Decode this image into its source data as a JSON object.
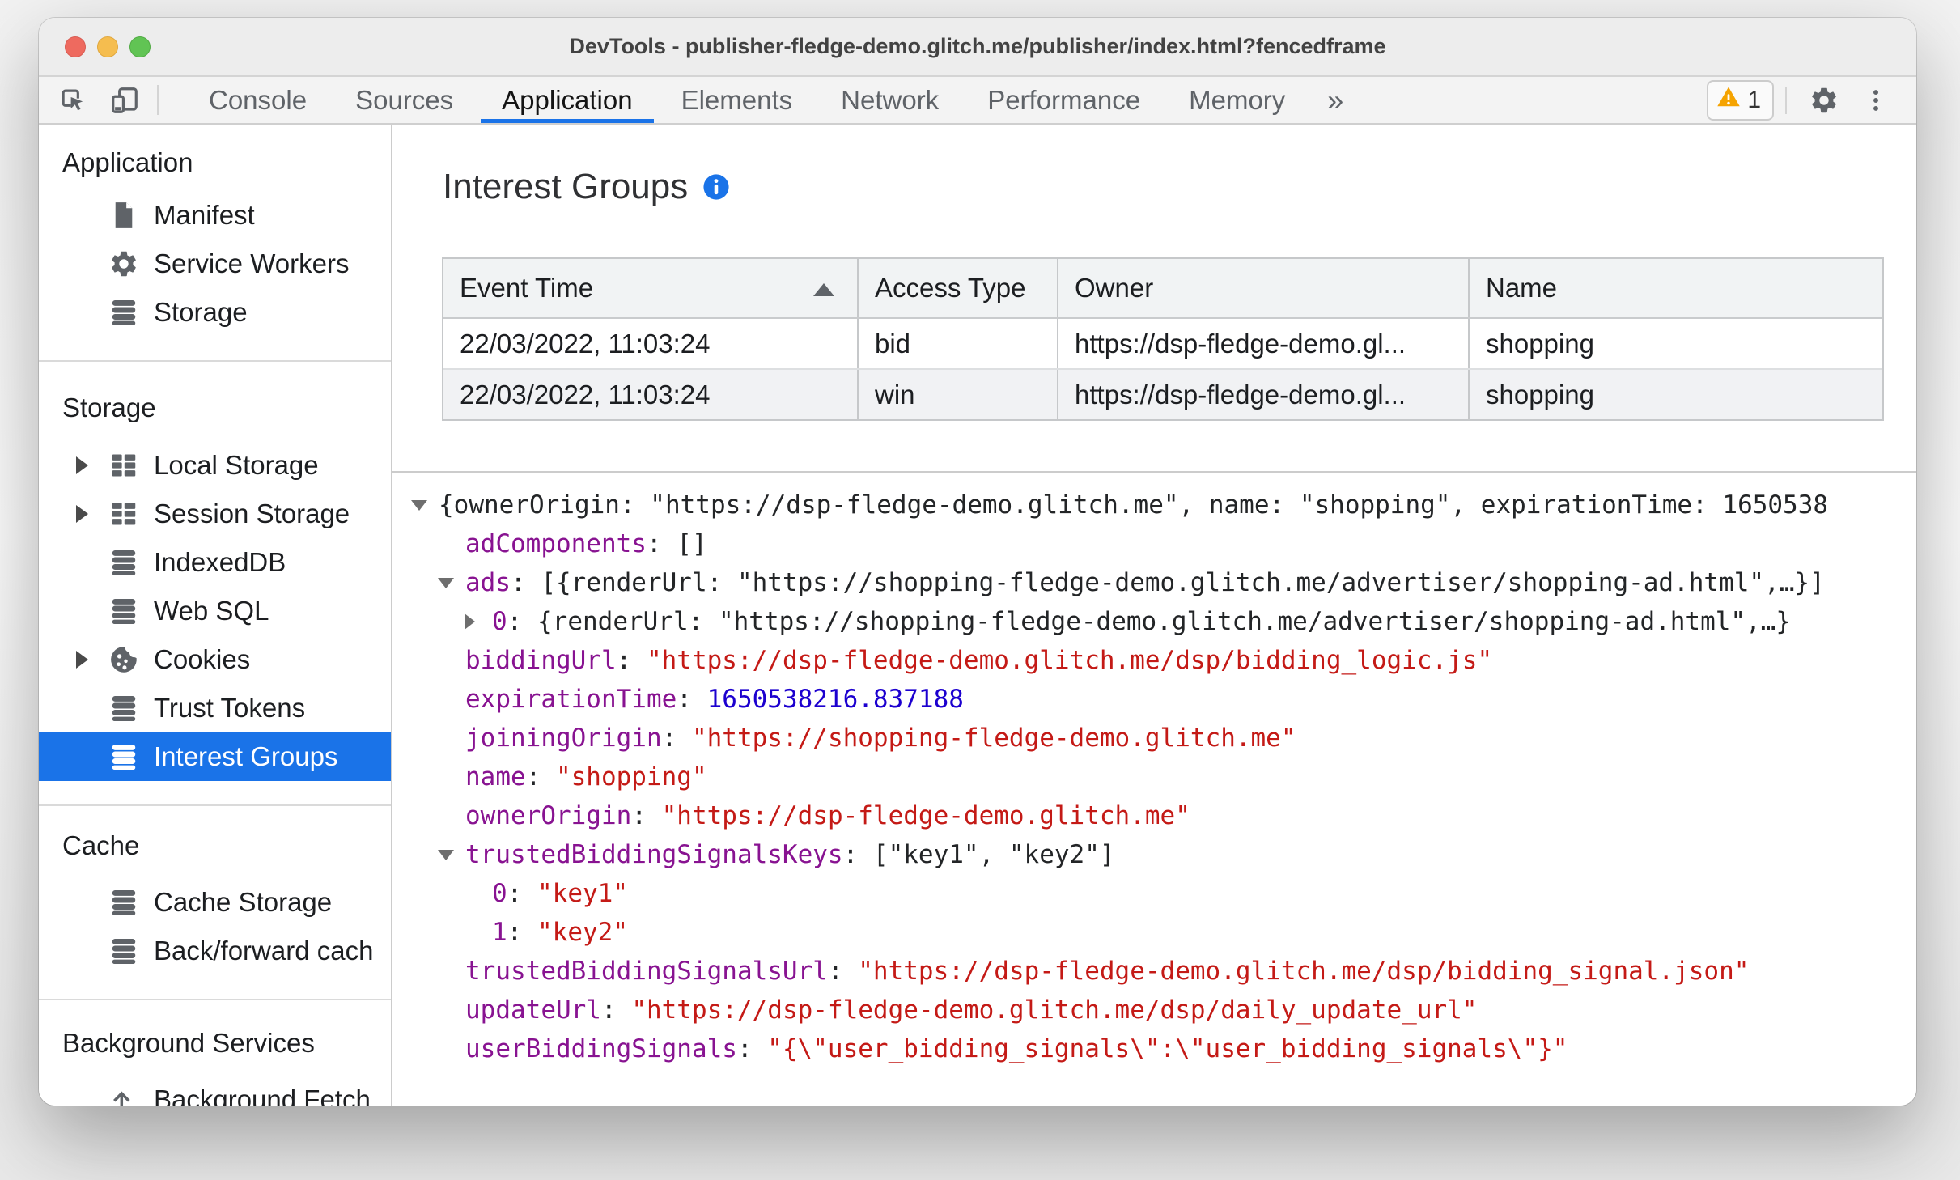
{
  "window": {
    "title": "DevTools - publisher-fledge-demo.glitch.me/publisher/index.html?fencedframe"
  },
  "toolbar": {
    "tabs": [
      "Console",
      "Sources",
      "Application",
      "Elements",
      "Network",
      "Performance",
      "Memory"
    ],
    "active_tab": "Application",
    "more_tabs_label": "»",
    "warning_count": "1"
  },
  "sidebar": {
    "sections": [
      {
        "title": "Application",
        "items": [
          {
            "label": "Manifest",
            "icon": "document-icon",
            "expandable": false
          },
          {
            "label": "Service Workers",
            "icon": "gear-icon",
            "expandable": false
          },
          {
            "label": "Storage",
            "icon": "database-icon",
            "expandable": false
          }
        ]
      },
      {
        "title": "Storage",
        "items": [
          {
            "label": "Local Storage",
            "icon": "grid-icon",
            "expandable": true
          },
          {
            "label": "Session Storage",
            "icon": "grid-icon",
            "expandable": true
          },
          {
            "label": "IndexedDB",
            "icon": "database-icon",
            "expandable": false
          },
          {
            "label": "Web SQL",
            "icon": "database-icon",
            "expandable": false
          },
          {
            "label": "Cookies",
            "icon": "cookie-icon",
            "expandable": true
          },
          {
            "label": "Trust Tokens",
            "icon": "database-icon",
            "expandable": false
          },
          {
            "label": "Interest Groups",
            "icon": "database-icon",
            "expandable": false,
            "selected": true
          }
        ]
      },
      {
        "title": "Cache",
        "items": [
          {
            "label": "Cache Storage",
            "icon": "database-icon",
            "expandable": false
          },
          {
            "label": "Back/forward cach",
            "icon": "database-icon",
            "expandable": false
          }
        ]
      },
      {
        "title": "Background Services",
        "items": [
          {
            "label": "Background Fetch",
            "icon": "fetch-icon",
            "expandable": false
          }
        ]
      }
    ]
  },
  "main": {
    "title": "Interest Groups",
    "table": {
      "columns": [
        "Event Time",
        "Access Type",
        "Owner",
        "Name"
      ],
      "sorted_column": "Event Time",
      "sort_direction": "asc",
      "rows": [
        [
          "22/03/2022, 11:03:24",
          "bid",
          "https://dsp-fledge-demo.gl...",
          "shopping"
        ],
        [
          "22/03/2022, 11:03:24",
          "win",
          "https://dsp-fledge-demo.gl...",
          "shopping"
        ]
      ]
    },
    "tree": {
      "rows": [
        {
          "indent": 0,
          "arrow": "down",
          "key": "",
          "value": "{ownerOrigin: \"https://dsp-fledge-demo.glitch.me\", name: \"shopping\", expirationTime: 1650538",
          "type": "preview"
        },
        {
          "indent": 1,
          "arrow": "",
          "key": "adComponents",
          "value": "[]",
          "type": "preview"
        },
        {
          "indent": 1,
          "arrow": "down",
          "key": "ads",
          "value": "[{renderUrl: \"https://shopping-fledge-demo.glitch.me/advertiser/shopping-ad.html\",…}]",
          "type": "preview"
        },
        {
          "indent": 2,
          "arrow": "right",
          "key": "0",
          "value": "{renderUrl: \"https://shopping-fledge-demo.glitch.me/advertiser/shopping-ad.html\",…}",
          "type": "preview"
        },
        {
          "indent": 1,
          "arrow": "",
          "key": "biddingUrl",
          "value": "\"https://dsp-fledge-demo.glitch.me/dsp/bidding_logic.js\"",
          "type": "string"
        },
        {
          "indent": 1,
          "arrow": "",
          "key": "expirationTime",
          "value": "1650538216.837188",
          "type": "number"
        },
        {
          "indent": 1,
          "arrow": "",
          "key": "joiningOrigin",
          "value": "\"https://shopping-fledge-demo.glitch.me\"",
          "type": "string"
        },
        {
          "indent": 1,
          "arrow": "",
          "key": "name",
          "value": "\"shopping\"",
          "type": "string"
        },
        {
          "indent": 1,
          "arrow": "",
          "key": "ownerOrigin",
          "value": "\"https://dsp-fledge-demo.glitch.me\"",
          "type": "string"
        },
        {
          "indent": 1,
          "arrow": "down",
          "key": "trustedBiddingSignalsKeys",
          "value": "[\"key1\", \"key2\"]",
          "type": "preview"
        },
        {
          "indent": 2,
          "arrow": "",
          "key": "0",
          "value": "\"key1\"",
          "type": "string"
        },
        {
          "indent": 2,
          "arrow": "",
          "key": "1",
          "value": "\"key2\"",
          "type": "string"
        },
        {
          "indent": 1,
          "arrow": "",
          "key": "trustedBiddingSignalsUrl",
          "value": "\"https://dsp-fledge-demo.glitch.me/dsp/bidding_signal.json\"",
          "type": "string"
        },
        {
          "indent": 1,
          "arrow": "",
          "key": "updateUrl",
          "value": "\"https://dsp-fledge-demo.glitch.me/dsp/daily_update_url\"",
          "type": "string"
        },
        {
          "indent": 1,
          "arrow": "",
          "key": "userBiddingSignals",
          "value": "\"{\\\"user_bidding_signals\\\":\\\"user_bidding_signals\\\"}\"",
          "type": "string"
        }
      ]
    }
  },
  "colors": {
    "accent": "#1a73e8",
    "key_purple": "#881391",
    "string_red": "#c41a16",
    "number_blue": "#1c00cf",
    "warning_amber": "#f5a300"
  }
}
